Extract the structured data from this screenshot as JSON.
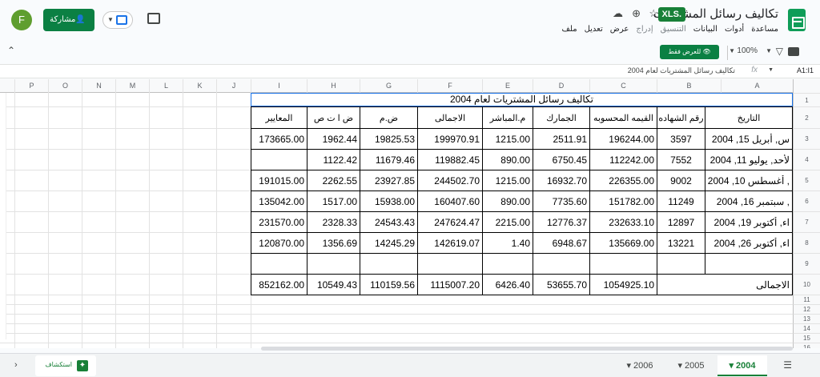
{
  "header": {
    "title": "تكاليف رسائل المشتريات",
    "badge": "XLS.",
    "menu": [
      "ملف",
      "تعديل",
      "عرض",
      "إدراج",
      "التنسيق",
      "البيانات",
      "أدوات",
      "مساعدة"
    ],
    "share_label": "مشاركة",
    "avatar_letter": "F"
  },
  "toolbar": {
    "zoom": "100%",
    "view_only": "للعرض فقط"
  },
  "formula": {
    "cell_ref": "A1:I1",
    "fx": "fx",
    "content": "تكاليف رسائل المشتريات لعام 2004"
  },
  "columns": [
    "A",
    "B",
    "C",
    "D",
    "E",
    "F",
    "G",
    "H",
    "I",
    "J",
    "K",
    "L",
    "M",
    "N",
    "O",
    "P"
  ],
  "rows": [
    "1",
    "2",
    "3",
    "4",
    "5",
    "6",
    "7",
    "8",
    "9",
    "10",
    "11",
    "12",
    "13",
    "14",
    "15",
    "16"
  ],
  "sheet": {
    "title": "تكاليف رسائل المشتريات لعام 2004",
    "headers": [
      "التاريخ",
      "رقم الشهاده",
      "القيمه المحسوبه",
      "الجمارك",
      "م.المباشر",
      "الاجمالى",
      "ض.م",
      "ض ا ت ص",
      "المعايير"
    ],
    "data": [
      [
        "س, أبريل 15, 2004",
        "3597",
        "196244.00",
        "2511.91",
        "1215.00",
        "199970.91",
        "19825.53",
        "1962.44",
        "173665.00"
      ],
      [
        "لأحد, يوليو 11, 2004",
        "7552",
        "112242.00",
        "6750.45",
        "890.00",
        "119882.45",
        "11679.46",
        "1122.42",
        ""
      ],
      [
        ", أغسطس 10, 2004",
        "9002",
        "226355.00",
        "16932.70",
        "1215.00",
        "244502.70",
        "23927.85",
        "2262.55",
        "191015.00"
      ],
      [
        ", سبتمبر 16, 2004",
        "11249",
        "151782.00",
        "7735.60",
        "890.00",
        "160407.60",
        "15938.00",
        "1517.00",
        "135042.00"
      ],
      [
        "اء, أكتوبر 19, 2004",
        "12897",
        "232633.10",
        "12776.37",
        "2215.00",
        "247624.47",
        "24543.43",
        "2328.33",
        "231570.00"
      ],
      [
        "اء, أكتوبر 26, 2004",
        "13221",
        "135669.00",
        "6948.67",
        "1.40",
        "142619.07",
        "14245.29",
        "1356.69",
        "120870.00"
      ]
    ],
    "total_label": "الاجمالى",
    "totals": [
      "1054925.10",
      "53655.70",
      "6426.40",
      "1115007.20",
      "110159.56",
      "10549.43",
      "852162.00"
    ]
  },
  "tabs": {
    "explore_label": "استكشاف",
    "sheets": [
      "2004",
      "2005",
      "2006"
    ],
    "active": "2004"
  }
}
